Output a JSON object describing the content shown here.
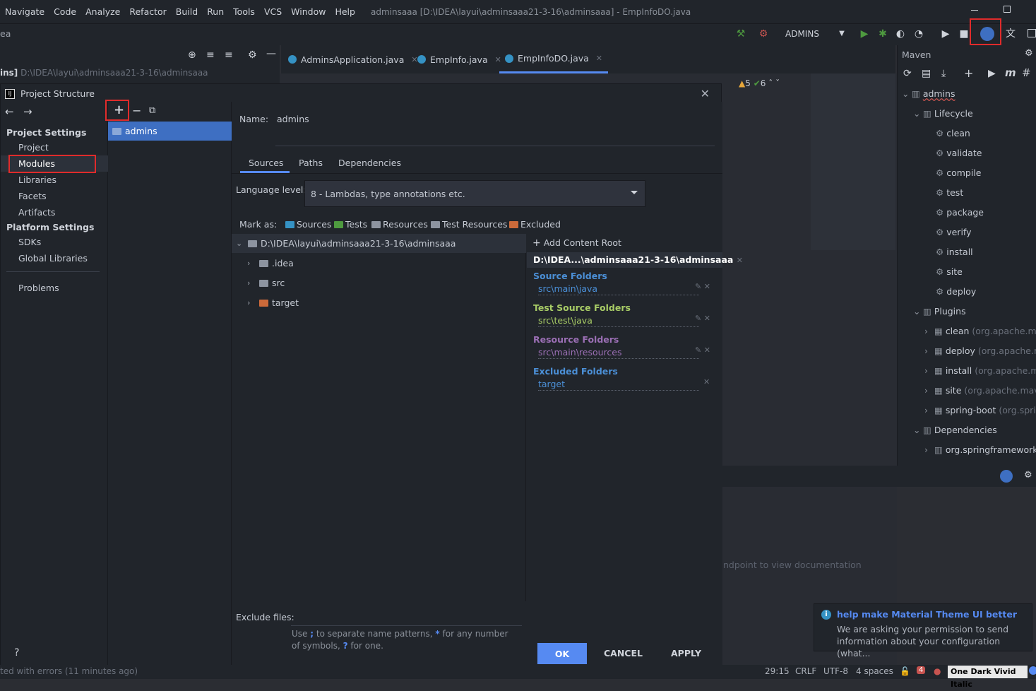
{
  "menu": [
    "Navigate",
    "Code",
    "Analyze",
    "Refactor",
    "Build",
    "Run",
    "Tools",
    "VCS",
    "Window",
    "Help"
  ],
  "window_title": "adminsaaa [D:\\IDEA\\layui\\adminsaaa21-3-16\\adminsaaa] - EmpInfoDO.java",
  "breadcrumb": "ea",
  "run_config": "ADMINS",
  "left_pane": {
    "path_prefix": "ins]",
    "path": "D:\\IDEA\\layui\\adminsaaa21-3-16\\adminsaaa"
  },
  "editor_tabs": [
    {
      "label": "AdminsApplication.java"
    },
    {
      "label": "EmpInfo.java"
    },
    {
      "label": "EmpInfoDO.java"
    }
  ],
  "inspections": {
    "warnings": "5",
    "checks": "6"
  },
  "maven": {
    "title": "Maven",
    "items": [
      {
        "label": "admins",
        "level": 0
      },
      {
        "label": "Lifecycle",
        "level": 1
      },
      {
        "label": "clean",
        "level": 2
      },
      {
        "label": "validate",
        "level": 2
      },
      {
        "label": "compile",
        "level": 2
      },
      {
        "label": "test",
        "level": 2
      },
      {
        "label": "package",
        "level": 2
      },
      {
        "label": "verify",
        "level": 2
      },
      {
        "label": "install",
        "level": 2
      },
      {
        "label": "site",
        "level": 2
      },
      {
        "label": "deploy",
        "level": 2
      },
      {
        "label": "Plugins",
        "level": 1
      },
      {
        "label": "clean",
        "suffix": "(org.apache.ma",
        "level": 2
      },
      {
        "label": "deploy",
        "suffix": "(org.apache.n",
        "level": 2
      },
      {
        "label": "install",
        "suffix": "(org.apache.ma",
        "level": 2
      },
      {
        "label": "site",
        "suffix": "(org.apache.mave",
        "level": 2
      },
      {
        "label": "spring-boot",
        "suffix": "(org.spri",
        "level": 2
      },
      {
        "label": "Dependencies",
        "level": 1
      },
      {
        "label": "org.springframework",
        "level": 2
      }
    ]
  },
  "dialog": {
    "title": "Project Structure",
    "project_settings": "Project Settings",
    "ps_items": [
      "Project",
      "Modules",
      "Libraries",
      "Facets",
      "Artifacts"
    ],
    "platform_settings": "Platform Settings",
    "pl_items": [
      "SDKs",
      "Global Libraries"
    ],
    "problems": "Problems",
    "module": "admins",
    "name_label": "Name:",
    "name_value": "admins",
    "tabs": [
      "Sources",
      "Paths",
      "Dependencies"
    ],
    "language_label": "Language level:",
    "language_value": "8 - Lambdas, type annotations etc.",
    "mark_as": "Mark as:",
    "marks": [
      {
        "label": "Sources",
        "color": "#3592c4"
      },
      {
        "label": "Tests",
        "color": "#4e9a3f"
      },
      {
        "label": "Resources",
        "color": "#8d94a0"
      },
      {
        "label": "Test Resources",
        "color": "#8d94a0"
      },
      {
        "label": "Excluded",
        "color": "#cc6a3a"
      }
    ],
    "tree_root": "D:\\IDEA\\layui\\adminsaaa21-3-16\\adminsaaa",
    "tree_children": [
      ".idea",
      "src",
      "target"
    ],
    "add_content_root": "Add Content Root",
    "content_root": "D:\\IDEA...\\adminsaaa21-3-16\\adminsaaa",
    "source_folders": "Source Folders",
    "source_path": "src\\main\\java",
    "test_folders": "Test Source Folders",
    "test_path": "src\\test\\java",
    "resource_folders": "Resource Folders",
    "resource_path": "src\\main\\resources",
    "excluded_folders": "Excluded Folders",
    "excluded_path": "target",
    "exclude_label": "Exclude files:",
    "hint_a": "Use",
    "hint_b": ";",
    "hint_c": "to separate name patterns,",
    "hint_d": "*",
    "hint_e": "for any number of symbols,",
    "hint_f": "?",
    "hint_g": "for one.",
    "ok": "OK",
    "cancel": "CANCEL",
    "apply": "APPLY",
    "help": "?"
  },
  "background_text": "ndpoint to view documentation",
  "notification": {
    "title": "help make Material Theme UI better",
    "body": "We are asking your permission to send information about your configuration (what..."
  },
  "status": {
    "left": "ted with errors (11 minutes ago)",
    "position": "29:15",
    "line_sep": "CRLF",
    "encoding": "UTF-8",
    "indent": "4 spaces",
    "errors": "4",
    "theme": "One Dark Vivid Italic"
  },
  "colors": {
    "accent": "#568af2",
    "highlight": "#e02b2b",
    "source": "#3592c4",
    "test": "#a8cc66",
    "resource": "#9b6fb5"
  }
}
